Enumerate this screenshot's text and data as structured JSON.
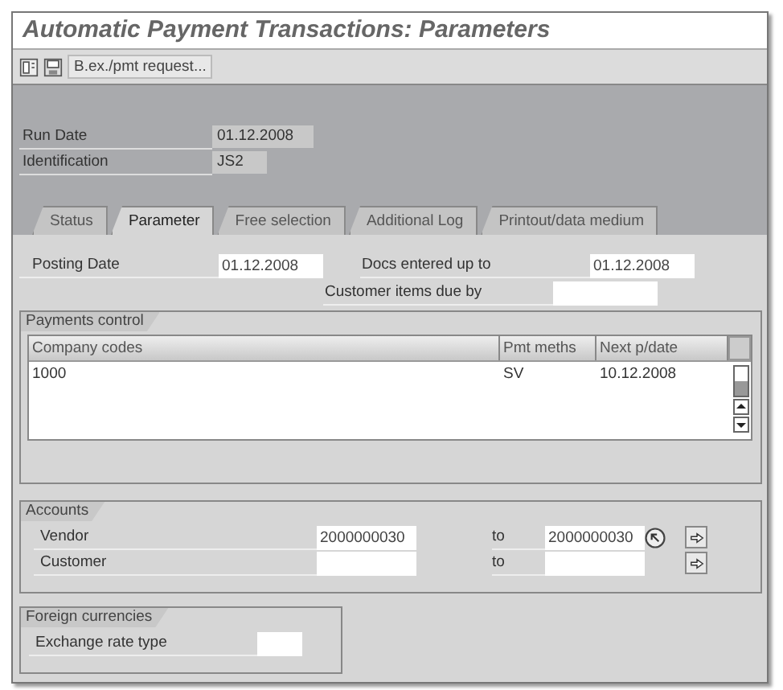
{
  "window": {
    "title": "Automatic Payment Transactions: Parameters"
  },
  "toolbar": {
    "button": "B.ex./pmt request..."
  },
  "header_fields": [
    {
      "label": "Run Date",
      "value": "01.12.2008"
    },
    {
      "label": "Identification",
      "value": "JS2"
    }
  ],
  "tabs": [
    {
      "label": "Status",
      "selected": false
    },
    {
      "label": "Parameter",
      "selected": true
    },
    {
      "label": "Free selection",
      "selected": false
    },
    {
      "label": "Additional Log",
      "selected": false
    },
    {
      "label": "Printout/data medium",
      "selected": false
    }
  ],
  "posting": {
    "posting_date": {
      "label": "Posting Date",
      "value": "01.12.2008"
    },
    "docs_entered": {
      "label": "Docs entered up to",
      "value": "01.12.2008"
    },
    "customer_items": {
      "label": "Customer items due by"
    }
  },
  "payments_control": {
    "title": "Payments control",
    "columns": [
      "Company codes",
      "Pmt meths",
      "Next p/date"
    ],
    "rows": [
      [
        "1000",
        "SV",
        "10.12.2008"
      ]
    ]
  },
  "accounts": {
    "title": "Accounts",
    "rows": [
      {
        "label": "Vendor",
        "from": "2000000030",
        "to_label": "to",
        "to": "2000000030",
        "multiple_selection": true
      },
      {
        "label": "Customer",
        "to_label": "to",
        "multiple_selection": false
      }
    ]
  },
  "foreign_currencies": {
    "title": "Foreign currencies",
    "label": "Exchange rate type"
  }
}
